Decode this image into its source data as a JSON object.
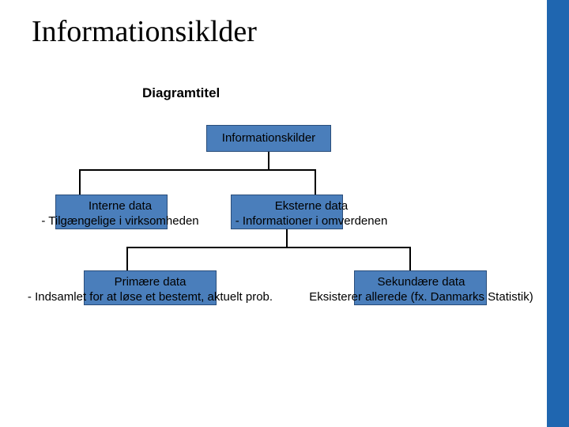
{
  "title": "Informationsiklder",
  "diagram_title": "Diagramtitel",
  "nodes": {
    "root": "Informationskilder",
    "interne": "Interne data\n- Tilgængelige i virksomheden",
    "eksterne": "Eksterne data\n- Informationer i omverdenen",
    "primaere": "Primære data\n- Indsamlet for at løse et bestemt, aktuelt prob.",
    "sekundaere": "Sekundære data\nEksisterer allerede (fx. Danmarks Statistik)"
  },
  "chart_data": {
    "type": "tree",
    "title": "Diagramtitel",
    "root": {
      "label": "Informationskilder",
      "children": [
        {
          "label": "Interne data",
          "description": "- Tilgængelige i virksomheden"
        },
        {
          "label": "Eksterne data",
          "description": "- Informationer i omverdenen",
          "children": [
            {
              "label": "Primære data",
              "description": "- Indsamlet for at løse et bestemt, aktuelt prob."
            },
            {
              "label": "Sekundære data",
              "description": "Eksisterer allerede (fx. Danmarks Statistik)"
            }
          ]
        }
      ]
    }
  },
  "colors": {
    "node_fill": "#4a7ebb",
    "node_border": "#2a4d7a",
    "sidebar": "#1f66b0"
  }
}
